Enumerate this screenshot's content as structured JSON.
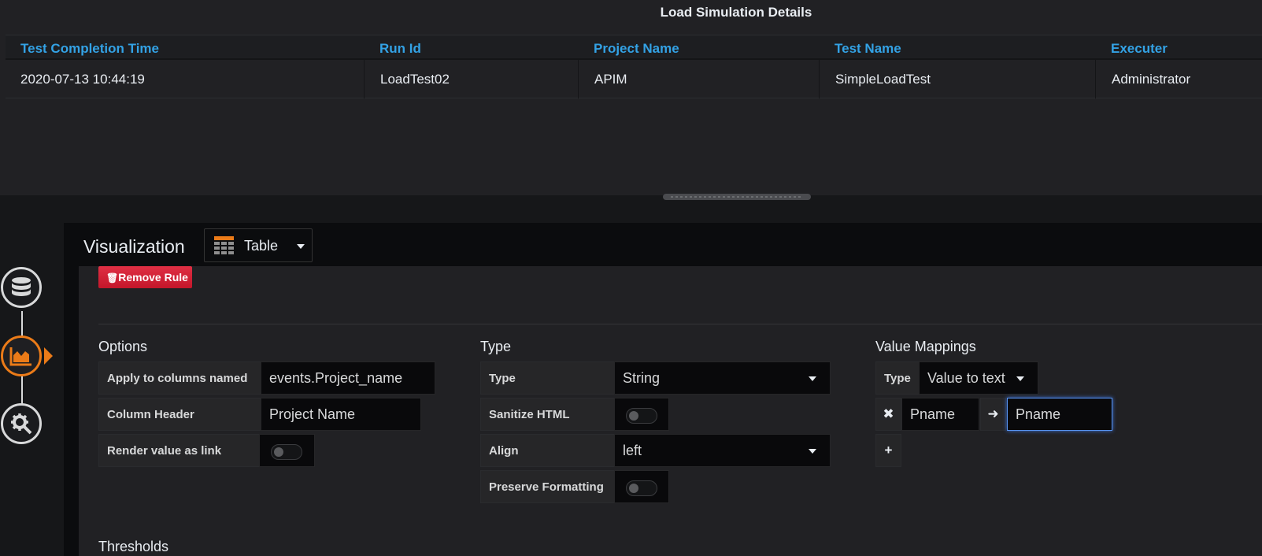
{
  "panel": {
    "title": "Load Simulation Details",
    "columns": [
      "Test Completion Time",
      "Run Id",
      "Project Name",
      "Test Name",
      "Executer"
    ],
    "rows": [
      [
        "2020-07-13 10:44:19",
        "LoadTest02",
        "APIM",
        "SimpleLoadTest",
        "Administrator"
      ]
    ]
  },
  "rail": {
    "icons": [
      "database-icon",
      "chart-icon",
      "gear-icon"
    ],
    "active": "chart-icon",
    "accent": "#eb7b18"
  },
  "editor": {
    "title": "Visualization",
    "viz_type": "Table",
    "remove_rule_label": "Remove Rule",
    "options": {
      "title": "Options",
      "apply_label": "Apply to columns named",
      "apply_value": "events.Project_name",
      "header_label": "Column Header",
      "header_value": "Project Name",
      "link_label": "Render value as link"
    },
    "type": {
      "title": "Type",
      "type_label": "Type",
      "type_value": "String",
      "sanitize_label": "Sanitize HTML",
      "align_label": "Align",
      "align_value": "left",
      "preserve_label": "Preserve Formatting"
    },
    "mappings": {
      "title": "Value Mappings",
      "type_label": "Type",
      "type_value": "Value to text",
      "from_value": "Pname",
      "to_value": "Pname"
    },
    "thresholds_title": "Thresholds"
  }
}
